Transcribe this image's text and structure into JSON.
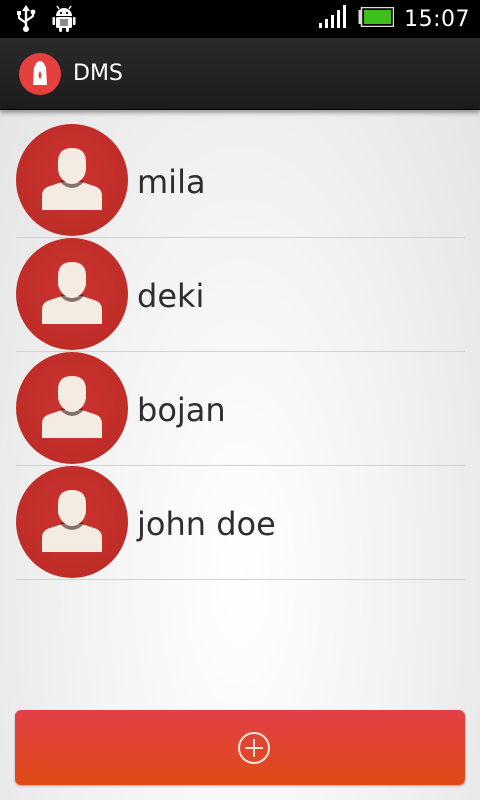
{
  "status_bar": {
    "time": "15:07",
    "icons": [
      "usb-icon",
      "android-debug-icon",
      "signal-icon",
      "battery-icon"
    ]
  },
  "app_bar": {
    "title": "DMS",
    "icon": "app-logo-icon"
  },
  "users": [
    {
      "name": "mila"
    },
    {
      "name": "deki"
    },
    {
      "name": "bojan"
    },
    {
      "name": "john doe"
    }
  ],
  "add_button": {
    "icon": "plus-circle-icon"
  },
  "colors": {
    "accent": "#e3403e",
    "avatar": "#c2302b",
    "button_top": "#e23f47",
    "button_bottom": "#de4a12",
    "battery": "#3fbf1c"
  }
}
